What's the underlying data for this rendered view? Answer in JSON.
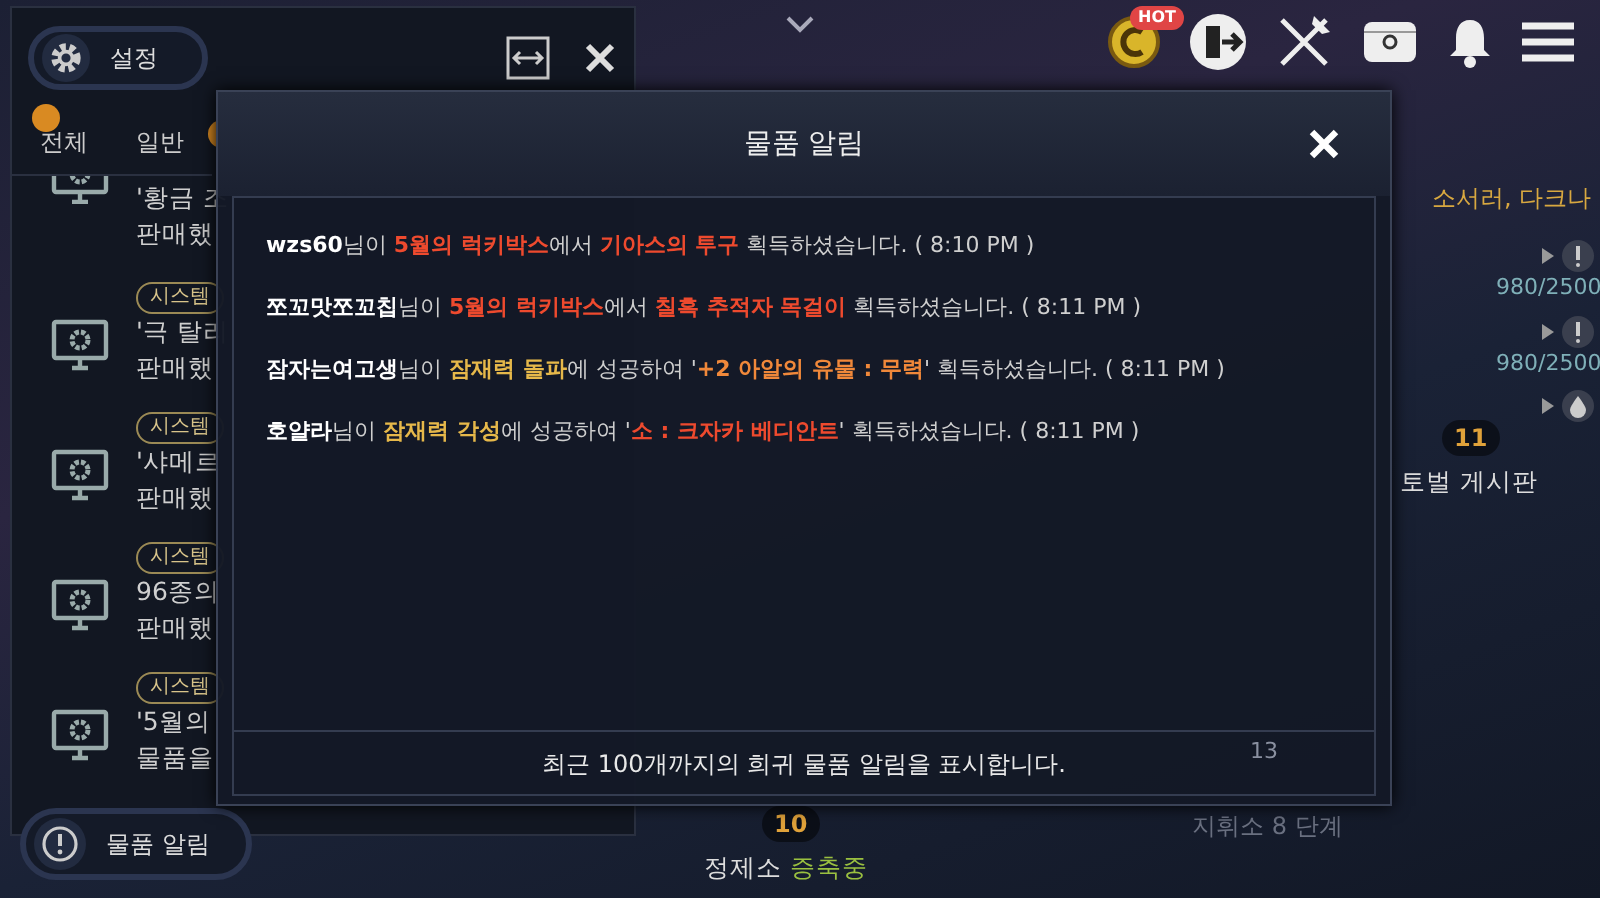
{
  "top_bar": {
    "hot_badge": "HOT"
  },
  "side_panel": {
    "settings_button": "설정",
    "tabs": [
      {
        "label": "전체",
        "alert": true
      },
      {
        "label": "일반",
        "alert": false
      }
    ],
    "covered_tab_alert": true,
    "items": [
      {
        "kind": "partial",
        "lines": [
          "'황금 조",
          "판매했"
        ]
      },
      {
        "kind": "full",
        "badge": "시스템",
        "lines": [
          "'극 탈리",
          "판매했"
        ]
      },
      {
        "kind": "full",
        "badge": "시스템",
        "lines": [
          "'샤메르",
          "판매했"
        ]
      },
      {
        "kind": "full",
        "badge": "시스템",
        "lines": [
          "96종의",
          "판매했"
        ]
      },
      {
        "kind": "full",
        "badge": "시스템",
        "lines": [
          "'5월의",
          "물품을"
        ]
      }
    ],
    "alert_button": "물품 알림"
  },
  "modal": {
    "title": "물품 알림",
    "messages": [
      {
        "parts": [
          {
            "text": "wzs60",
            "color": "#ffffff"
          },
          {
            "text": "님이 ",
            "color": "#cfcfcf"
          },
          {
            "text": "5월의 럭키박스",
            "color": "#ee4a2e"
          },
          {
            "text": "에서 ",
            "color": "#cfcfcf"
          },
          {
            "text": "기아스의 투구",
            "color": "#ee4a2e"
          },
          {
            "text": " 획득하셨습니다. ( 8:10 PM )",
            "color": "#cfcfcf"
          }
        ]
      },
      {
        "parts": [
          {
            "text": "쪼꼬맛쪼꼬칩",
            "color": "#ffffff"
          },
          {
            "text": "님이 ",
            "color": "#cfcfcf"
          },
          {
            "text": "5월의 럭키박스",
            "color": "#ee4a2e"
          },
          {
            "text": "에서 ",
            "color": "#cfcfcf"
          },
          {
            "text": "칠흑 추적자 목걸이",
            "color": "#ee4a2e"
          },
          {
            "text": " 획득하셨습니다. ( 8:11 PM )",
            "color": "#cfcfcf"
          }
        ]
      },
      {
        "parts": [
          {
            "text": "잠자는여고생",
            "color": "#ffffff"
          },
          {
            "text": "님이 ",
            "color": "#cfcfcf"
          },
          {
            "text": "잠재력 돌파",
            "color": "#e6b84a"
          },
          {
            "text": "에 성공하여 '",
            "color": "#cfcfcf"
          },
          {
            "text": "+2 아알의 유물 : 무력",
            "color": "#f0883a"
          },
          {
            "text": "' 획득하셨습니다. ( 8:11 PM )",
            "color": "#cfcfcf"
          }
        ]
      },
      {
        "parts": [
          {
            "text": "호얄라",
            "color": "#ffffff"
          },
          {
            "text": "님이 ",
            "color": "#cfcfcf"
          },
          {
            "text": "잠재력 각성",
            "color": "#e6b84a"
          },
          {
            "text": "에 성공하여 '",
            "color": "#cfcfcf"
          },
          {
            "text": "소 : 크자카 베디안트",
            "color": "#ee4a2e"
          },
          {
            "text": "' 획득하셨습니다. ( 8:11 PM )",
            "color": "#cfcfcf"
          }
        ]
      }
    ],
    "footer": "최근 100개까지의 희귀 물품 알림을 표시합니다."
  },
  "scene": {
    "party_label": "소서러, 다크나",
    "quests": [
      {
        "kind": "alert",
        "reading": "980/2500"
      },
      {
        "kind": "alert",
        "reading": "980/2500"
      },
      {
        "kind": "drop"
      }
    ],
    "board": {
      "count": "11",
      "label": "토벌 게시판"
    },
    "command": {
      "count": "13",
      "label": "지휘소 8 단계"
    },
    "refinery": {
      "count": "10",
      "name": "정제소",
      "status": "증축중"
    }
  }
}
